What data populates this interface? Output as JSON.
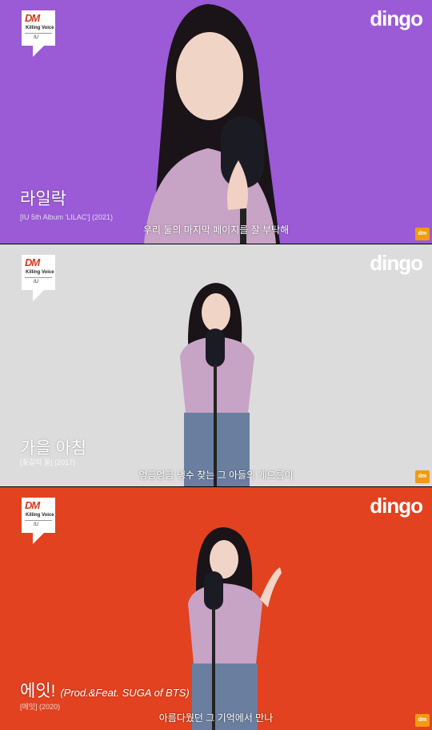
{
  "panels": [
    {
      "badge": {
        "logo": "DM",
        "series": "Killing Voice",
        "artist": "IU"
      },
      "brand": "dingo",
      "corner_logo": "dm",
      "song_title": "라일락",
      "song_title_suffix": "",
      "song_subtitle": "[IU 5th Album 'LILAC'] (2021)",
      "caption": "우리 둘의 마지막 페이지를 잘 부탁해",
      "bg_color": "#9b5ad6"
    },
    {
      "badge": {
        "logo": "DM",
        "series": "Killing Voice",
        "artist": "IU"
      },
      "brand": "dingo",
      "corner_logo": "dm",
      "song_title": "가을 아침",
      "song_title_suffix": "",
      "song_subtitle": "[꽃갈피 둘] (2017)",
      "caption": "엉금엉금 냉수 찾는 그 아들의 게으름이",
      "bg_color": "#dcdcdc"
    },
    {
      "badge": {
        "logo": "DM",
        "series": "Killing Voice",
        "artist": "IU"
      },
      "brand": "dingo",
      "corner_logo": "dm",
      "song_title": "에잇!",
      "song_title_suffix": "(Prod.&Feat. SUGA of BTS)",
      "song_subtitle": "[에잇] (2020)",
      "caption": "아름다웠던 그 기억에서 만나",
      "bg_color": "#e2421f"
    }
  ]
}
